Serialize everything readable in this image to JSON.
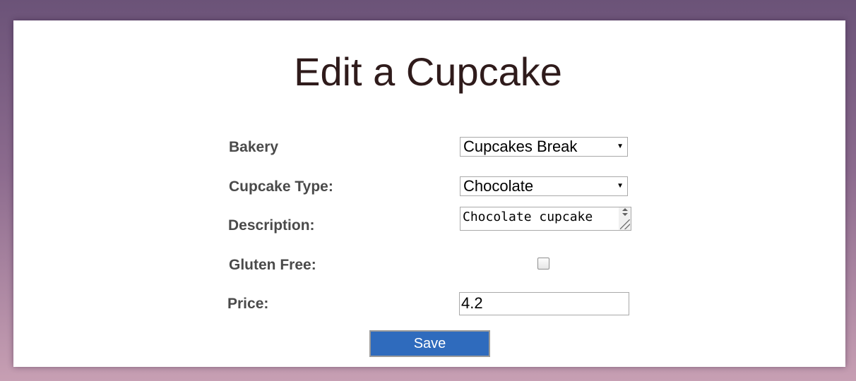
{
  "page": {
    "title": "Edit a Cupcake"
  },
  "form": {
    "bakery": {
      "label": "Bakery",
      "value": "Cupcakes Break"
    },
    "cupcake_type": {
      "label": "Cupcake Type:",
      "value": "Chocolate"
    },
    "description": {
      "label": "Description:",
      "value": "Chocolate cupcake"
    },
    "gluten_free": {
      "label": "Gluten Free:",
      "checked": false
    },
    "price": {
      "label": "Price:",
      "value": "4.2"
    },
    "save_label": "Save"
  },
  "colors": {
    "button": "#2f6bbd",
    "title": "#2f1b1b",
    "label": "#4a4a4a"
  }
}
